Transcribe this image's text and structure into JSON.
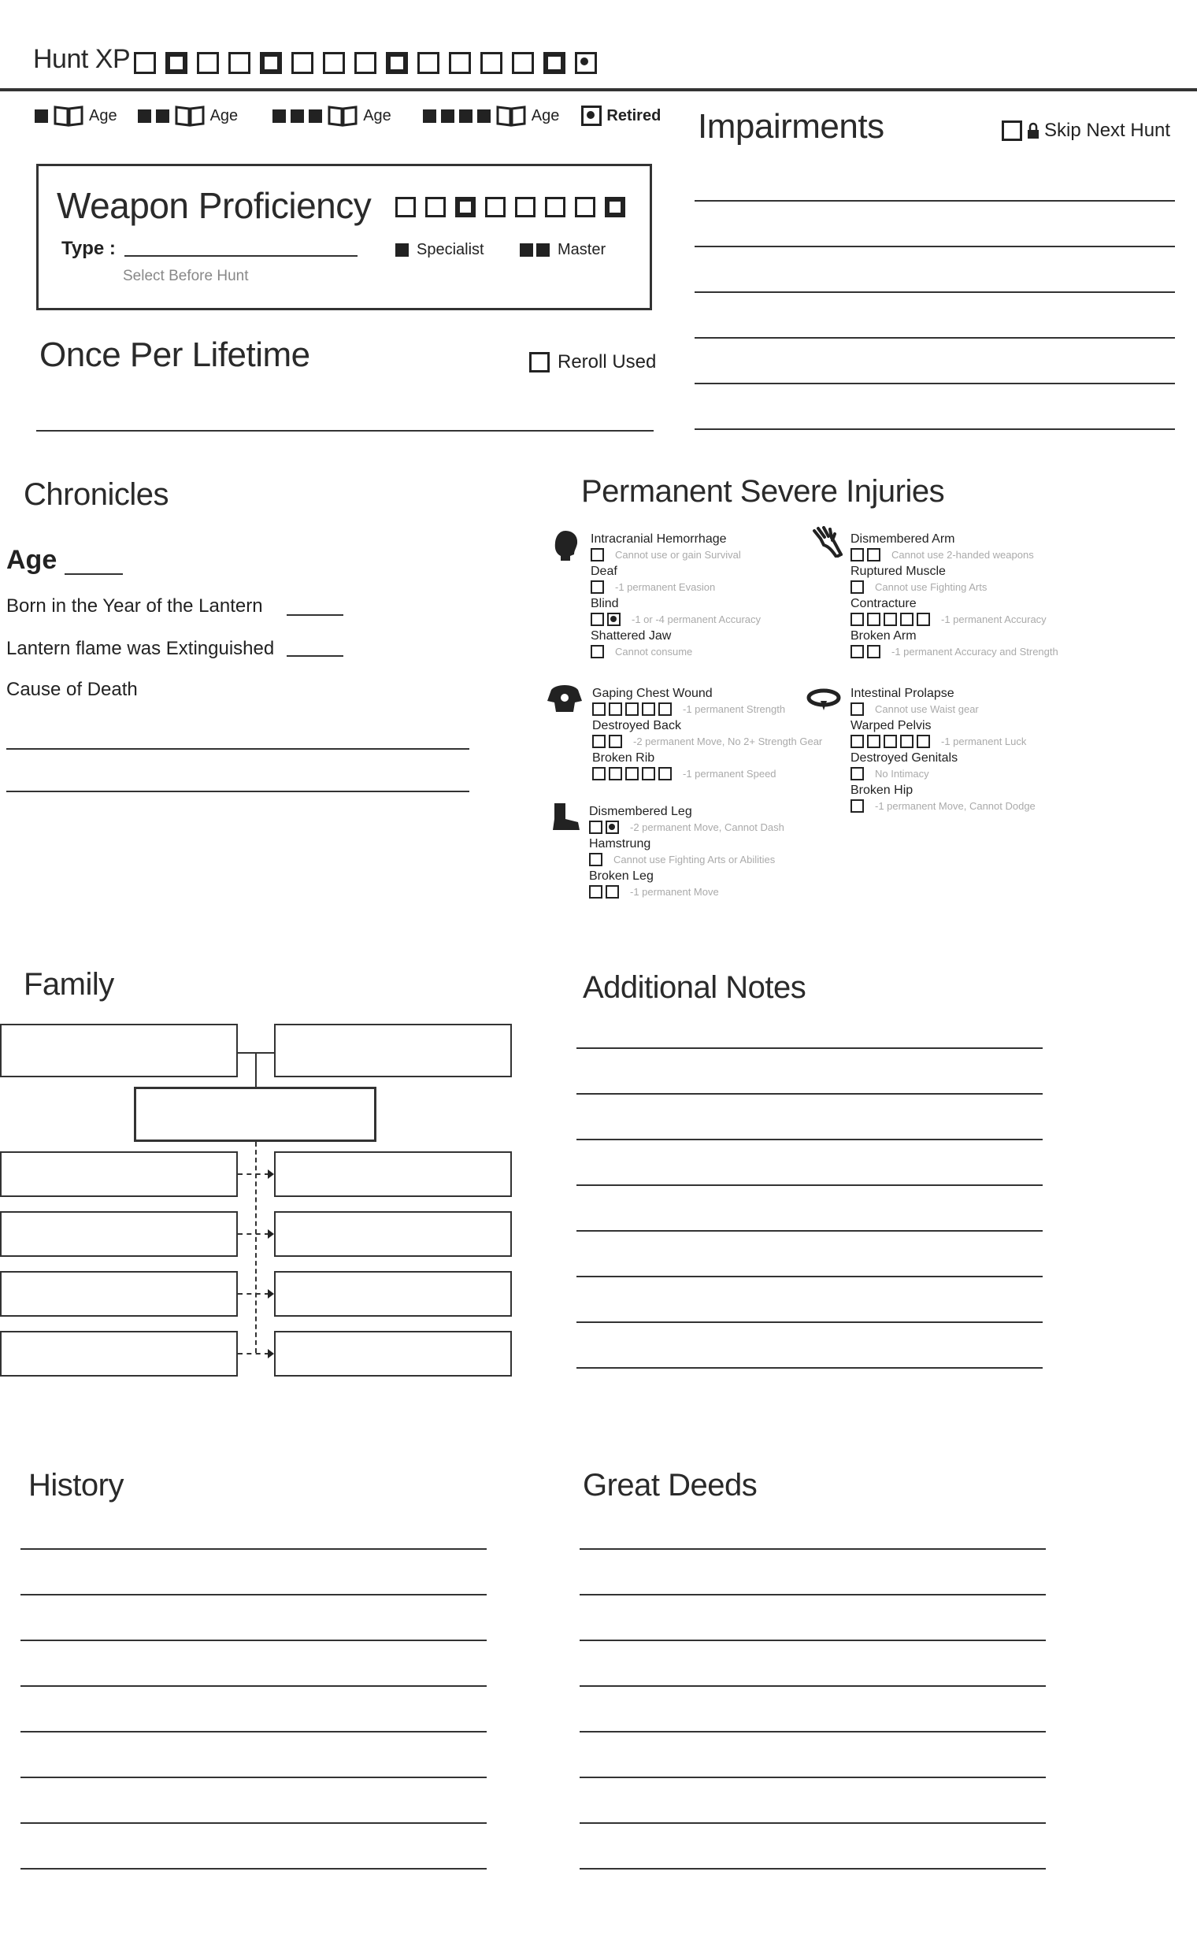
{
  "hunt_xp": {
    "label": "Hunt XP",
    "boxes": 16
  },
  "age_track": {
    "age_label": "Age",
    "retired_label": "Retired"
  },
  "impairments": {
    "title": "Impairments",
    "skip_label": "Skip Next Hunt"
  },
  "weapon": {
    "title": "Weapon Proficiency",
    "type_label": "Type :",
    "hint": "Select Before Hunt",
    "specialist": "Specialist",
    "master": "Master"
  },
  "once": {
    "title": "Once Per Lifetime",
    "reroll": "Reroll Used"
  },
  "chronicles": {
    "title": "Chronicles",
    "age": "Age",
    "born": "Born in the Year of the Lantern",
    "extinguished": "Lantern flame was Extinguished",
    "cause": "Cause of Death"
  },
  "injuries": {
    "title": "Permanent Severe Injuries",
    "head": [
      {
        "name": "Intracranial Hemorrhage",
        "boxes": 1,
        "marked": [],
        "effect": "Cannot use or gain Survival"
      },
      {
        "name": "Deaf",
        "boxes": 1,
        "marked": [],
        "effect": "-1 permanent Evasion"
      },
      {
        "name": "Blind",
        "boxes": 2,
        "marked": [
          1
        ],
        "effect": "-1 or -4 permanent Accuracy"
      },
      {
        "name": "Shattered Jaw",
        "boxes": 1,
        "marked": [],
        "effect": "Cannot consume"
      }
    ],
    "arms": [
      {
        "name": "Dismembered Arm",
        "boxes": 2,
        "marked": [],
        "effect": "Cannot use 2-handed weapons"
      },
      {
        "name": "Ruptured Muscle",
        "boxes": 1,
        "marked": [],
        "effect": "Cannot use Fighting Arts"
      },
      {
        "name": "Contracture",
        "boxes": 5,
        "marked": [],
        "effect": "-1 permanent Accuracy"
      },
      {
        "name": "Broken Arm",
        "boxes": 2,
        "marked": [],
        "effect": "-1 permanent Accuracy and Strength"
      }
    ],
    "body": [
      {
        "name": "Gaping Chest Wound",
        "boxes": 5,
        "marked": [],
        "effect": "-1 permanent Strength"
      },
      {
        "name": "Destroyed Back",
        "boxes": 2,
        "marked": [],
        "effect": "-2 permanent Move, No 2+ Strength Gear"
      },
      {
        "name": "Broken Rib",
        "boxes": 5,
        "marked": [],
        "effect": "-1 permanent Speed"
      }
    ],
    "waist": [
      {
        "name": "Intestinal Prolapse",
        "boxes": 1,
        "marked": [],
        "effect": "Cannot use Waist gear"
      },
      {
        "name": "Warped Pelvis",
        "boxes": 5,
        "marked": [],
        "effect": "-1 permanent Luck"
      },
      {
        "name": "Destroyed Genitals",
        "boxes": 1,
        "marked": [],
        "effect": "No Intimacy"
      },
      {
        "name": "Broken Hip",
        "boxes": 1,
        "marked": [],
        "effect": "-1 permanent Move, Cannot Dodge"
      }
    ],
    "legs": [
      {
        "name": "Dismembered Leg",
        "boxes": 2,
        "marked": [
          1
        ],
        "effect": "-2 permanent Move, Cannot Dash"
      },
      {
        "name": "Hamstrung",
        "boxes": 1,
        "marked": [],
        "effect": "Cannot use Fighting Arts or Abilities"
      },
      {
        "name": "Broken Leg",
        "boxes": 2,
        "marked": [],
        "effect": "-1 permanent Move"
      }
    ]
  },
  "family": {
    "title": "Family"
  },
  "notes": {
    "title": "Additional Notes"
  },
  "history": {
    "title": "History"
  },
  "deeds": {
    "title": "Great Deeds"
  }
}
